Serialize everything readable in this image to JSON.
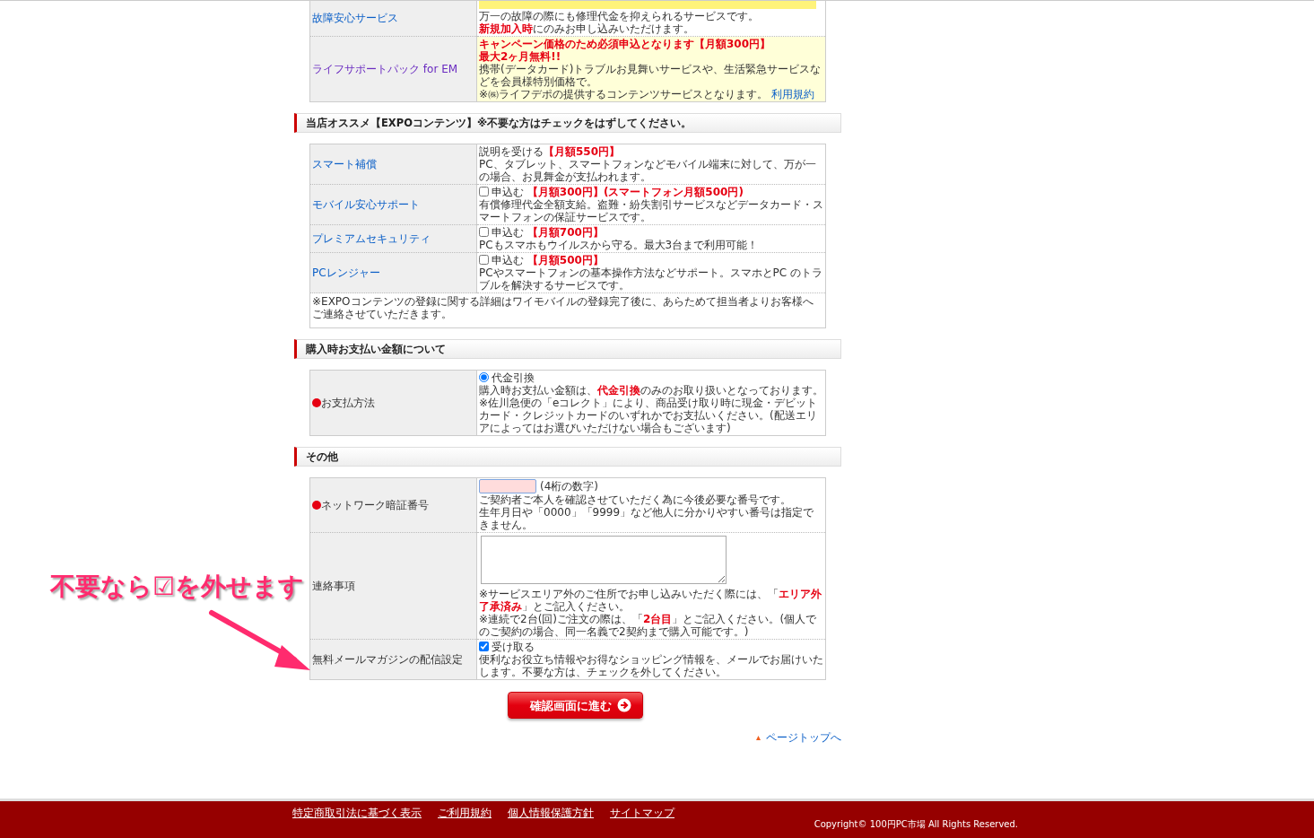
{
  "sections": [
    {
      "rows": [
        {
          "label": "故障安心サービス",
          "kind": "link",
          "highlighted": false,
          "banner_strip": true,
          "lines": [
            "万一の故障の際にも修理代金を抑えられるサービスです。",
            "**新規加入時**にのみお申し込みいただけます。"
          ]
        },
        {
          "label": "ライフサポートパック for EM",
          "kind": "visited-link",
          "highlighted": true,
          "lines": [
            "**キャンペーン価格のため必須申込となります【月額300円】**",
            "**最大2ヶ月無料!!**",
            "携帯(データカード)トラブルお見舞いサービスや、生活緊急サービスなどを会員様特別価格で。",
            {
              "text": "※㈱ライフデポの提供するコンテンツサービスとなります。",
              "link": "利用規約"
            }
          ]
        }
      ]
    },
    {
      "title": "当店オススメ【EXPOコンテンツ】※不要な方はチェックをはずしてください。",
      "rows": [
        {
          "label": "スマート補償",
          "kind": "link",
          "highlighted": false,
          "lines": [
            "説明を受ける**【月額550円】**",
            "PC、タブレット、スマートフォンなどモバイル端末に対して、万が一の場合、お見舞金が支払われます。"
          ]
        },
        {
          "label": "モバイル安心サポート",
          "kind": "link",
          "highlighted": false,
          "control": {
            "kind": "checkbox",
            "checked": false,
            "label": "申込む **【月額300円】(スマートフォン月額500円)**"
          },
          "lines": [
            "有償修理代金全額支給。盗難・紛失割引サービスなどデータカード・スマートフォンの保証サービスです。"
          ]
        },
        {
          "label": "プレミアムセキュリティ",
          "kind": "link",
          "highlighted": false,
          "control": {
            "kind": "checkbox",
            "checked": false,
            "label": "申込む **【月額700円】**"
          },
          "lines": [
            "PCもスマホもウイルスから守る。最大3台まで利用可能！"
          ]
        },
        {
          "label": "PCレンジャー",
          "kind": "link",
          "highlighted": false,
          "control": {
            "kind": "checkbox",
            "checked": false,
            "label": "申込む **【月額500円】**"
          },
          "lines": [
            "PCやスマートフォンの基本操作方法などサポート。スマホとPC のトラブルを解決するサービスです。"
          ]
        }
      ],
      "note": "※EXPOコンテンツの登録に関する詳細はワイモバイルの登録完了後に、あらためて担当者よりお客様へご連絡させていただきます。"
    },
    {
      "title": "購入時お支払い金額について",
      "rows": [
        {
          "label": "お支払方法",
          "kind": "required",
          "highlighted": false,
          "control": {
            "kind": "radio",
            "checked": true,
            "label": "代金引換"
          },
          "lines": [
            "購入時お支払い金額は、**代金引換**のみのお取り扱いとなっております。",
            "※佐川急便の「eコレクト」により、商品受け取り時に現金・デビットカード・クレジットカードのいずれかでお支払いください。(配送エリアによってはお選びいただけない場合もございます)"
          ]
        }
      ]
    },
    {
      "title": "その他",
      "rows": [
        {
          "label": "ネットワーク暗証番号",
          "kind": "required",
          "highlighted": false,
          "control": {
            "kind": "text-input",
            "hint": "(4桁の数字)"
          },
          "lines": [
            "ご契約者ご本人を確認させていただく為に今後必要な番号です。",
            "生年月日や「0000」「9999」など他人に分かりやすい番号は指定できません。"
          ]
        },
        {
          "label": "連絡事項",
          "kind": "plain",
          "highlighted": false,
          "control": {
            "kind": "textarea"
          },
          "lines": [
            "※サービスエリア外のご住所でお申し込みいただく際には、「**エリア外了承済み**」とご記入ください。",
            "※連続で2台(回)ご注文の際は、「**2台目**」とご記入ください。(個人でのご契約の場合、同一名義で2契約まで購入可能です。)"
          ]
        },
        {
          "label": "無料メールマガジンの配信設定",
          "kind": "plain",
          "highlighted": false,
          "control": {
            "kind": "checkbox",
            "checked": true,
            "label": "受け取る"
          },
          "lines": [
            "便利なお役立ち情報やお得なショッピング情報を、メールでお届けいたします。不要な方は、チェックを外してください。"
          ]
        }
      ]
    }
  ],
  "submit_button": "確認画面に進む",
  "page_top_link": "ページトップへ",
  "annotation": "不要なら☑を外せます",
  "footer": {
    "links": [
      "特定商取引法に基づく表示",
      "ご利用規約",
      "個人情報保護方針",
      "サイトマップ"
    ],
    "copyright": "Copyright© 100円PC市場 All Rights Reserved."
  }
}
